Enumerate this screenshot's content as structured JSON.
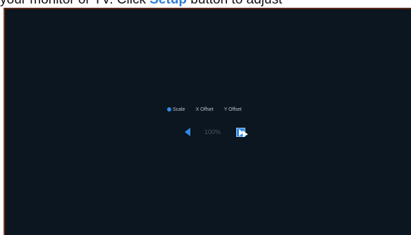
{
  "instruction": {
    "before": "your monitor or TV. Click ",
    "link": "Setup",
    "after": " button to adjust"
  },
  "adjust_panel": {
    "options": [
      {
        "label": "Scale",
        "selected": true
      },
      {
        "label": "X Offset",
        "selected": false
      },
      {
        "label": "Y Offset",
        "selected": false
      }
    ],
    "scale_value": "100%"
  },
  "colors": {
    "accent": "#2f8ae6",
    "screen_bg": "#0b1620",
    "link": "#2f7fd6"
  },
  "icons": {
    "prev": "arrow-left-icon",
    "next": "arrow-right-icon",
    "pointer": "mouse-cursor-icon"
  }
}
